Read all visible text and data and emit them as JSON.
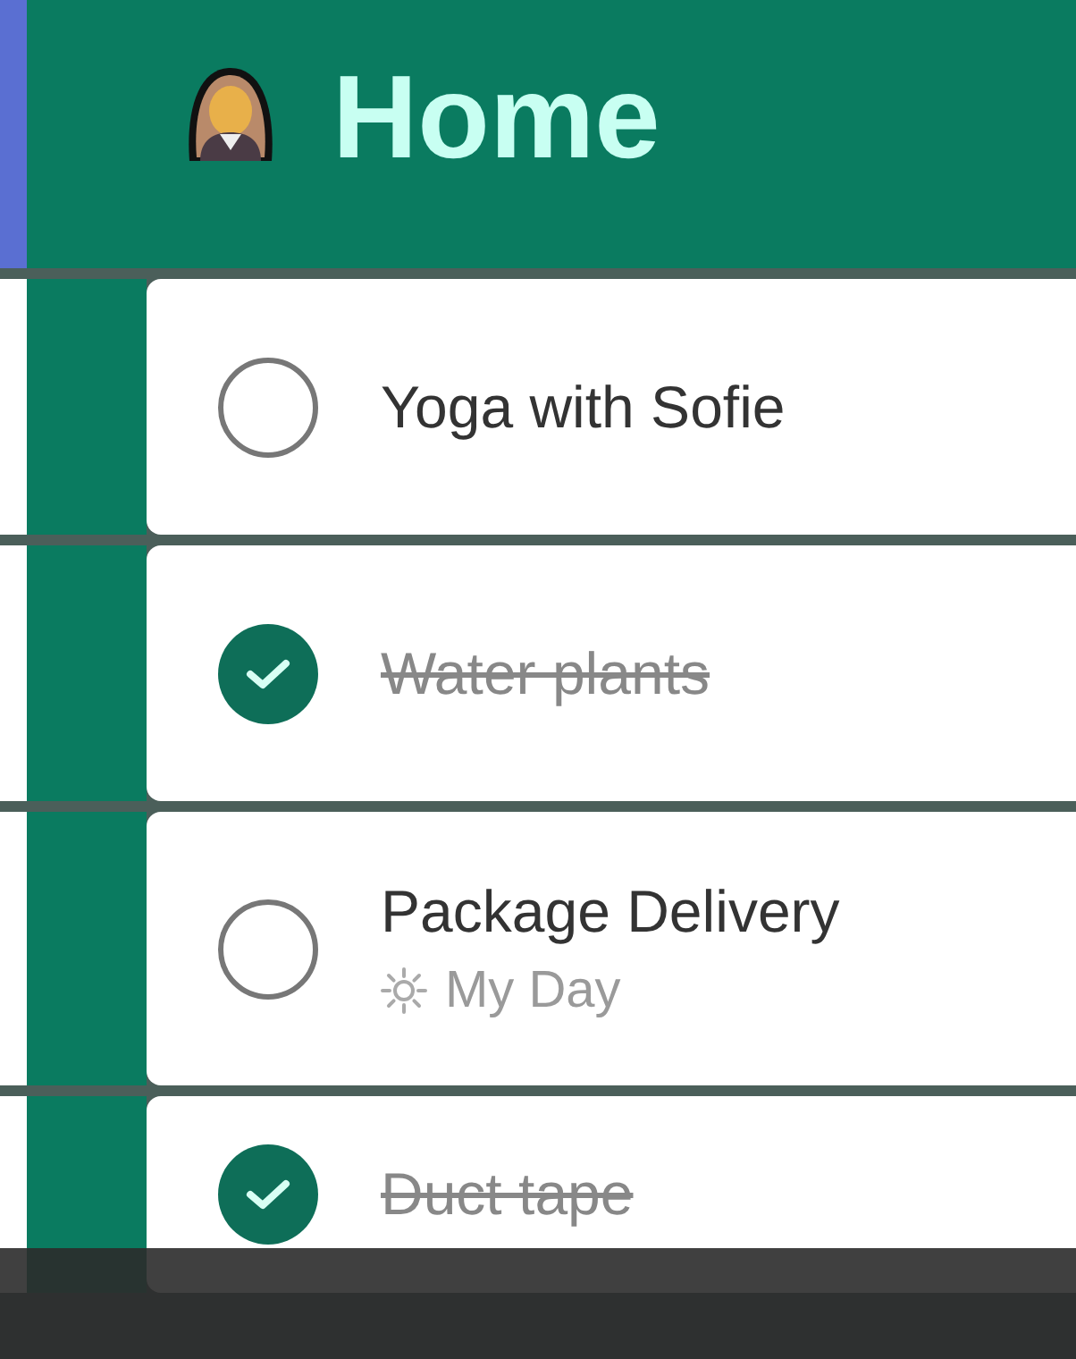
{
  "list": {
    "title": "Home"
  },
  "tasks": [
    {
      "title": "Yoga with Sofie",
      "completed": false
    },
    {
      "title": "Water plants",
      "completed": true
    },
    {
      "title": "Package Delivery",
      "completed": false,
      "tag": "My Day"
    },
    {
      "title": "Duct tape",
      "completed": true
    }
  ]
}
